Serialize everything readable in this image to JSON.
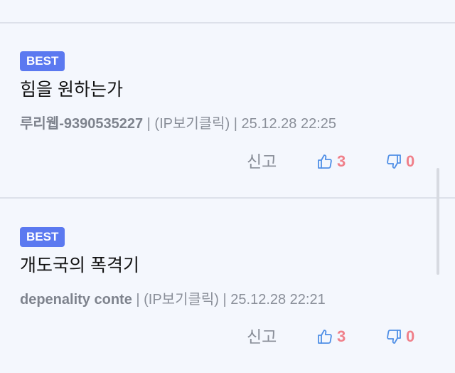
{
  "comments": [
    {
      "badge": "BEST",
      "title": "힘을 원하는가",
      "author": "루리웹-9390535227",
      "separator": " | ",
      "ip": "(IP보기클릭)",
      "timestamp": "25.12.28 22:25",
      "report_label": "신고",
      "upvotes": "3",
      "downvotes": "0"
    },
    {
      "badge": "BEST",
      "title": "개도국의 폭격기",
      "author": "depenality conte",
      "separator": " | ",
      "ip": "(IP보기클릭)",
      "timestamp": "25.12.28 22:21",
      "report_label": "신고",
      "upvotes": "3",
      "downvotes": "0"
    }
  ],
  "colors": {
    "badge_bg": "#5b79f0",
    "vote_count": "#f0808a",
    "thumb_icon": "#4f8fe6",
    "background": "#f4f7fd"
  },
  "icons": [
    "thumbs-up-icon",
    "thumbs-down-icon"
  ]
}
